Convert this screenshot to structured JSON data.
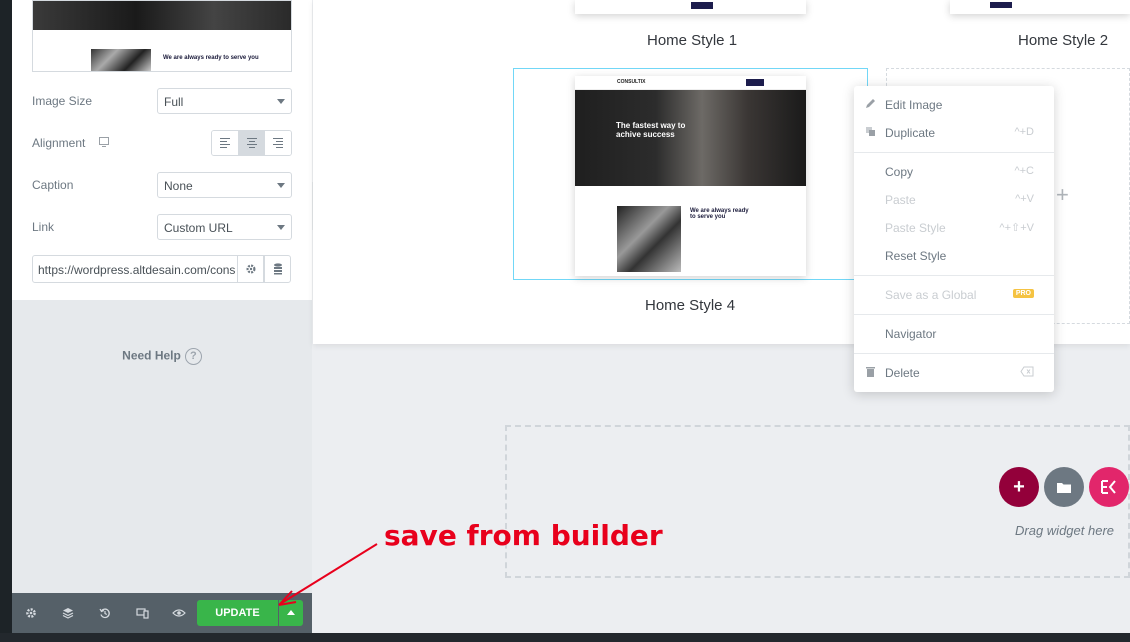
{
  "panel": {
    "thumb_headline": "We are always ready to serve you",
    "controls": {
      "image_size": {
        "label": "Image Size",
        "value": "Full"
      },
      "alignment": {
        "label": "Alignment",
        "selected": "center"
      },
      "caption": {
        "label": "Caption",
        "value": "None"
      },
      "link": {
        "label": "Link",
        "value": "Custom URL"
      },
      "url": "https://wordpress.altdesain.com/cons"
    },
    "need_help": "Need Help",
    "need_help_icon": "?"
  },
  "footer": {
    "update_label": "UPDATE",
    "icons": [
      "settings-icon",
      "layers-icon",
      "history-icon",
      "responsive-icon",
      "preview-eye-icon"
    ]
  },
  "templates": {
    "style1": "Home Style 1",
    "style2": "Home Style 2",
    "style4": "Home Style 4",
    "style4_logo": "CONSULTIX",
    "style4_hero": "The fastest way to achive success",
    "style4_sub": "We are always ready to serve you"
  },
  "context_menu": {
    "items": [
      {
        "label": "Edit Image",
        "key": "",
        "disabled": false
      },
      {
        "label": "Duplicate",
        "key": "^+D",
        "disabled": false
      },
      {
        "label": "Copy",
        "key": "^+C",
        "disabled": false
      },
      {
        "label": "Paste",
        "key": "^+V",
        "disabled": true
      },
      {
        "label": "Paste Style",
        "key": "^+⇧+V",
        "disabled": true
      },
      {
        "label": "Reset Style",
        "key": "",
        "disabled": false
      },
      {
        "label": "Save as a Global",
        "key": "",
        "disabled": true
      },
      {
        "label": "Navigator",
        "key": "",
        "disabled": false
      },
      {
        "label": "Delete",
        "key": "",
        "disabled": false
      }
    ],
    "pro_badge": "PRO"
  },
  "drop_zone": {
    "text": "Drag widget here"
  },
  "annotation": "save from builder",
  "colors": {
    "update_green": "#39b54a",
    "fab_add": "#93003a",
    "fab_folder": "#6d7882",
    "fab_ek": "#e2266b",
    "annotation_red": "#e8001c",
    "selection_blue": "#71d7f7"
  }
}
